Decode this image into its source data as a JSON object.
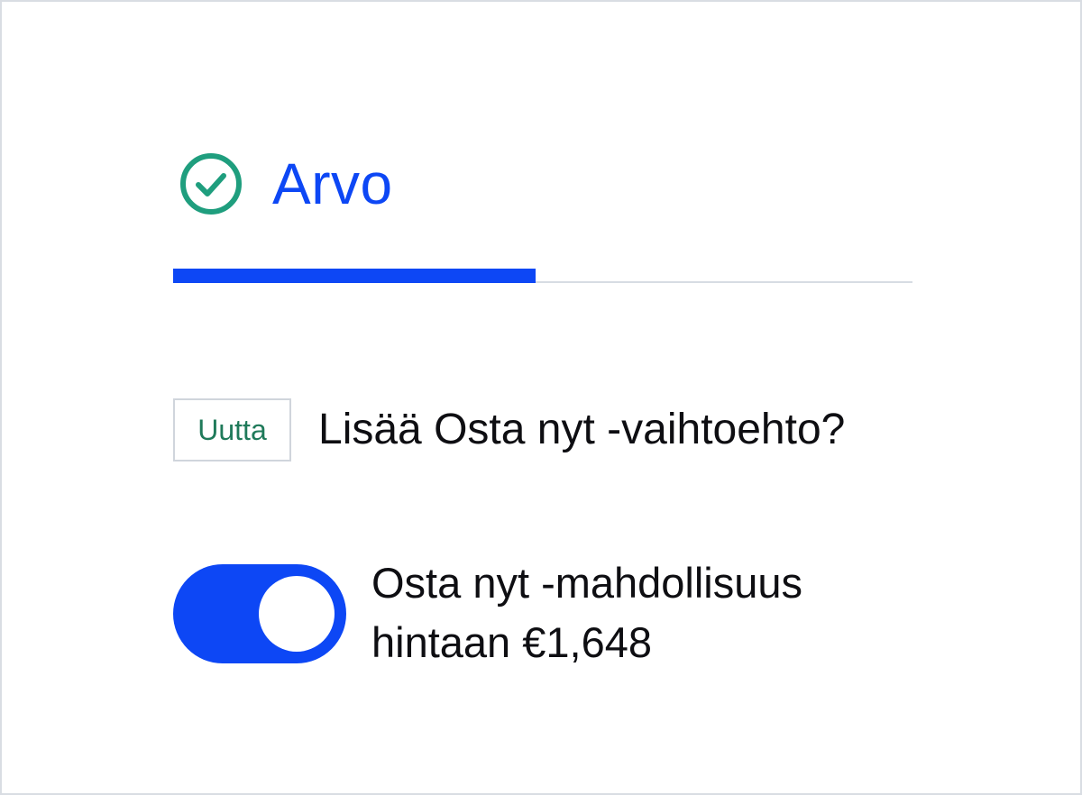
{
  "section": {
    "icon": "check-circle-icon",
    "title": "Arvo",
    "progress": 0.49
  },
  "question": {
    "badge": "Uutta",
    "text": "Lisää Osta nyt -vaihtoehto?"
  },
  "option": {
    "toggle_state": "on",
    "label_line1": "Osta nyt -mahdollisuus",
    "label_line2": "hintaan €1,648"
  },
  "colors": {
    "accent_blue": "#0d47f5",
    "check_green": "#1f9e7e",
    "badge_green": "#1f7a5a",
    "border_gray": "#d0d5dc"
  }
}
